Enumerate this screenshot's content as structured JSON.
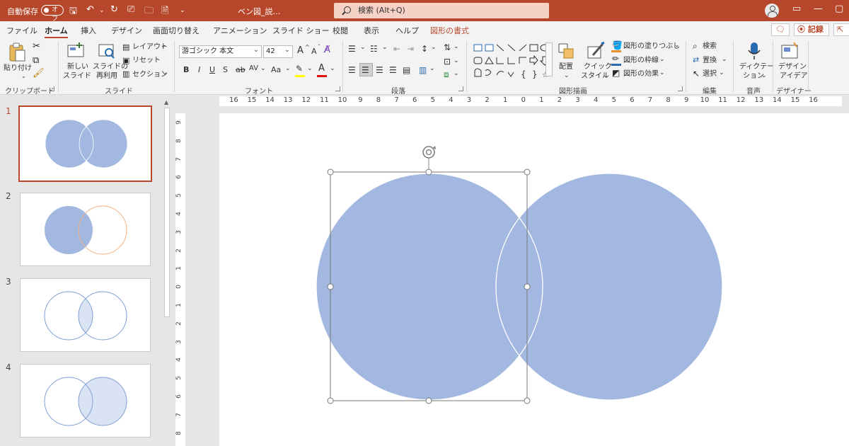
{
  "titlebar": {
    "autosave_label": "自動保存",
    "autosave_state": "オフ",
    "document_title": "ベン図_説…",
    "search_placeholder": "検索 (Alt+Q)"
  },
  "tabs": [
    {
      "label": "ファイル",
      "active": false
    },
    {
      "label": "ホーム",
      "active": true
    },
    {
      "label": "挿入",
      "active": false
    },
    {
      "label": "デザイン",
      "active": false
    },
    {
      "label": "画面切り替え",
      "active": false
    },
    {
      "label": "アニメーション",
      "active": false
    },
    {
      "label": "スライド ショー",
      "active": false
    },
    {
      "label": "校閲",
      "active": false
    },
    {
      "label": "表示",
      "active": false
    },
    {
      "label": "ヘルプ",
      "active": false
    },
    {
      "label": "図形の書式",
      "active": false,
      "contextual": true
    }
  ],
  "actions": {
    "record_label": "記録"
  },
  "ribbon": {
    "clipboard": {
      "label": "クリップボード",
      "paste_label": "貼り付け"
    },
    "slides": {
      "label": "スライド",
      "new_slide_line1": "新しい",
      "new_slide_line2": "スライド",
      "reuse_line1": "スライドの",
      "reuse_line2": "再利用",
      "layout_label": "レイアウト",
      "reset_label": "リセット",
      "section_label": "セクション"
    },
    "font": {
      "label": "フォント",
      "font_name": "游ゴシック 本文",
      "font_size": "42",
      "bold": "B",
      "italic": "I",
      "underline": "U",
      "shadow": "S",
      "strike": "ab",
      "spacing": "AV",
      "case": "Aa",
      "grow": "A",
      "shrink": "A"
    },
    "paragraph": {
      "label": "段落"
    },
    "drawing": {
      "label": "図形描画",
      "arrange_label": "配置",
      "quick_style_line1": "クイック",
      "quick_style_line2": "スタイル",
      "fill_label": "図形の塗りつぶし",
      "outline_label": "図形の枠線",
      "effects_label": "図形の効果"
    },
    "editing": {
      "label": "編集",
      "find_label": "検索",
      "replace_label": "置換",
      "select_label": "選択"
    },
    "voice": {
      "label": "音声",
      "dictate_line1": "ディクテー",
      "dictate_line2": "ション"
    },
    "designer": {
      "label": "デザイナー",
      "ideas_line1": "デザイン",
      "ideas_line2": "アイデア"
    }
  },
  "slides_panel": [
    {
      "number": "1",
      "selected": true,
      "variant": "both-filled"
    },
    {
      "number": "2",
      "selected": false,
      "variant": "left-filled"
    },
    {
      "number": "3",
      "selected": false,
      "variant": "intersection"
    },
    {
      "number": "4",
      "selected": false,
      "variant": "right-filled"
    }
  ],
  "ruler": {
    "horizontal": [
      "16",
      "15",
      "14",
      "13",
      "12",
      "11",
      "10",
      "9",
      "8",
      "7",
      "6",
      "5",
      "4",
      "3",
      "2",
      "1",
      "0",
      "1",
      "2",
      "3",
      "4",
      "5",
      "6",
      "7",
      "8",
      "9",
      "10",
      "11",
      "12",
      "13",
      "14",
      "15",
      "16"
    ],
    "vertical": [
      "9",
      "8",
      "7",
      "6",
      "5",
      "4",
      "3",
      "2",
      "1",
      "0",
      "1",
      "2",
      "3",
      "4",
      "5",
      "6",
      "7",
      "8"
    ]
  },
  "colors": {
    "accent": "#b7472a",
    "shape_fill": "#a2b8e0",
    "thumb_outline_blue": "#7f9fd4",
    "thumb_outline_orange": "#f4b183",
    "thumb_light_fill": "#dae3f3"
  }
}
